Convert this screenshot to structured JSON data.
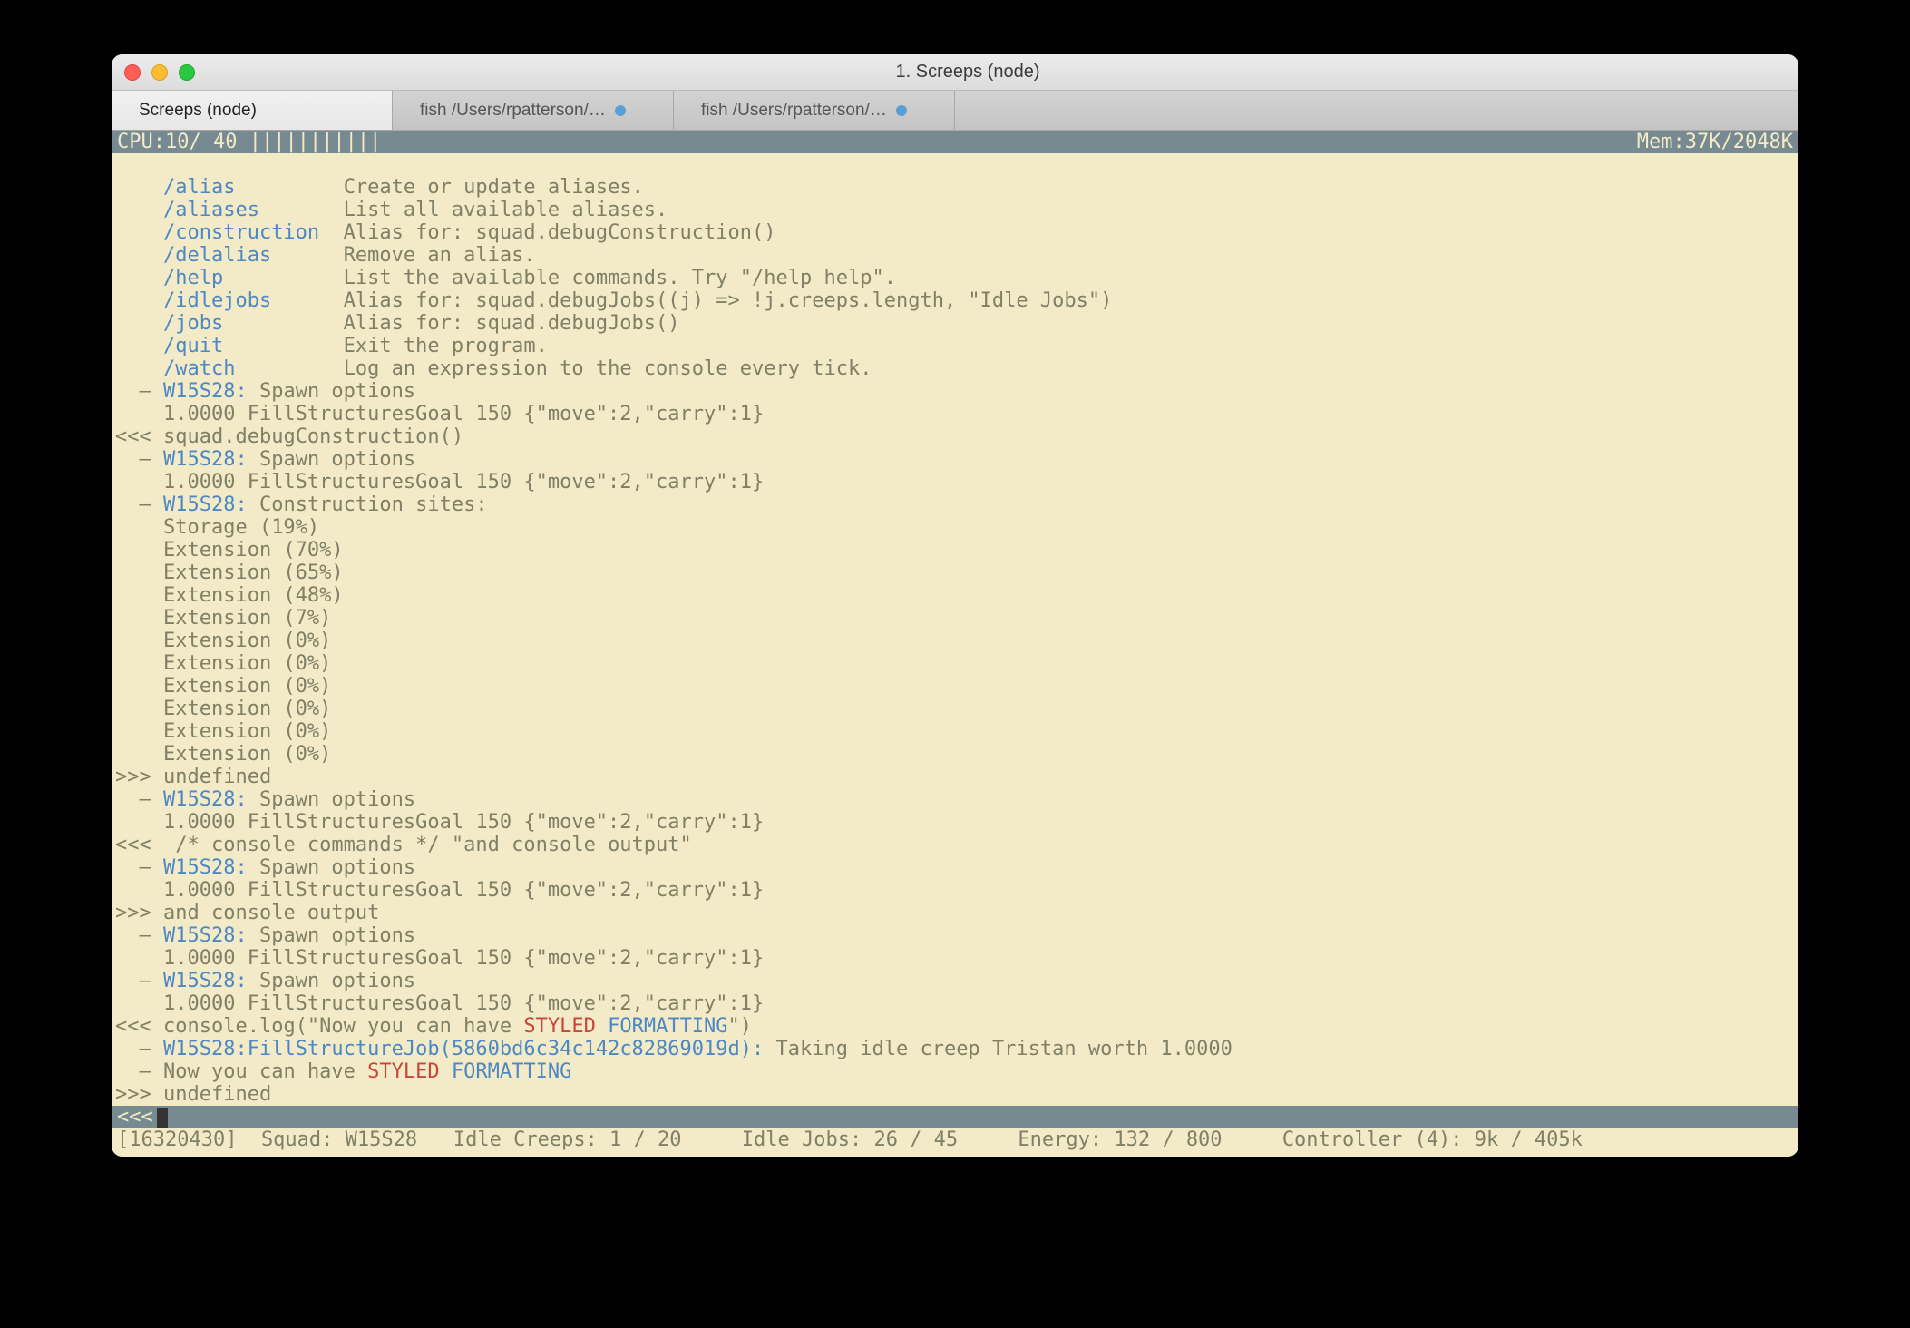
{
  "window": {
    "title": "1. Screeps (node)"
  },
  "tabs": [
    {
      "label": "Screeps (node)",
      "active": true,
      "modified": false
    },
    {
      "label": "fish  /Users/rpatterson/…",
      "active": false,
      "modified": true
    },
    {
      "label": "fish  /Users/rpatterson/…",
      "active": false,
      "modified": true
    }
  ],
  "status": {
    "cpu_label": "CPU:",
    "cpu_value": "10/ 40",
    "cpu_bars": "|||||||||||",
    "mem_label": "Mem:",
    "mem_value": "37K/2048K"
  },
  "help": [
    {
      "cmd": "/alias",
      "desc": "Create or update aliases."
    },
    {
      "cmd": "/aliases",
      "desc": "List all available aliases."
    },
    {
      "cmd": "/construction",
      "desc": "Alias for: squad.debugConstruction()"
    },
    {
      "cmd": "/delalias",
      "desc": "Remove an alias."
    },
    {
      "cmd": "/help",
      "desc": "List the available commands. Try \"/help help\"."
    },
    {
      "cmd": "/idlejobs",
      "desc": "Alias for: squad.debugJobs((j) => !j.creeps.length, \"Idle Jobs\")"
    },
    {
      "cmd": "/jobs",
      "desc": "Alias for: squad.debugJobs()"
    },
    {
      "cmd": "/quit",
      "desc": "Exit the program."
    },
    {
      "cmd": "/watch",
      "desc": "Log an expression to the console every tick."
    }
  ],
  "spawn_line1": "W15S28:",
  "spawn_line2": " Spawn options",
  "fill_line": "1.0000 FillStructuresGoal 150 {\"move\":2,\"carry\":1}",
  "chev_in": "<<<",
  "chev_out": ">>>",
  "dash": "–",
  "cmd_debug_construction": " squad.debugConstruction()",
  "csites_header": " Construction sites:",
  "csites": [
    "Storage (19%)",
    "Extension (70%)",
    "Extension (65%)",
    "Extension (48%)",
    "Extension (7%)",
    "Extension (0%)",
    "Extension (0%)",
    "Extension (0%)",
    "Extension (0%)",
    "Extension (0%)",
    "Extension (0%)"
  ],
  "undefined": " undefined",
  "cmd_comment": "  /* console commands */ \"and console output\"",
  "and_out": " and console output",
  "cmd_console_log_pre": " console.log(\"Now you can have ",
  "styled": "STYLED",
  "formatting": "FORMATTING",
  "cmd_console_log_post": "\")",
  "job_prefix": "W15S28:FillStructureJob(5860bd6c34c142c82869019d):",
  "job_suffix": " Taking idle creep Tristan worth 1.0000",
  "now_pre": "Now you can have ",
  "prompt_marker": "<<<",
  "footer": "[16320430]  Squad: W15S28   Idle Creeps: 1 / 20     Idle Jobs: 26 / 45     Energy: 132 / 800     Controller (4): 9k / 405k"
}
